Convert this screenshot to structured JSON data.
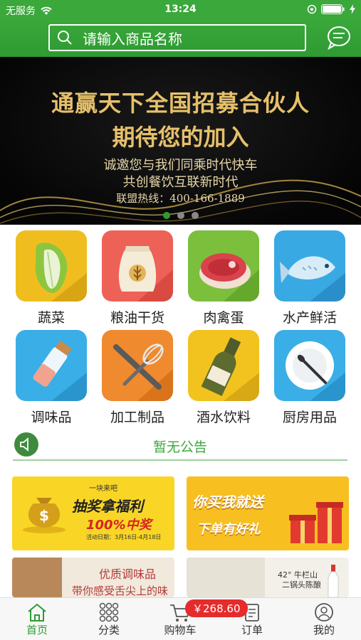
{
  "status": {
    "carrier": "无服务",
    "time": "13:24"
  },
  "search": {
    "placeholder": "请输入商品名称"
  },
  "banner": {
    "line1": "通赢天下全国招募合伙人",
    "line2": "期待您的加入",
    "line3": "诚邀您与我们同乘时代快车",
    "line4": "共创餐饮互联新时代",
    "hotline": "联盟热线：400-166-1889",
    "page_count": 3,
    "active_page": 1
  },
  "categories": [
    {
      "label": "蔬菜",
      "icon": "cabbage-icon",
      "color": "#f0bd1f"
    },
    {
      "label": "粮油干货",
      "icon": "grain-sack-icon",
      "color": "#ee6156"
    },
    {
      "label": "肉禽蛋",
      "icon": "meat-icon",
      "color": "#7cbf3c"
    },
    {
      "label": "水产鲜活",
      "icon": "fish-icon",
      "color": "#39a9e3"
    },
    {
      "label": "调味品",
      "icon": "salt-bottle-icon",
      "color": "#3aaee6"
    },
    {
      "label": "加工制品",
      "icon": "whisk-icon",
      "color": "#f08a2e"
    },
    {
      "label": "酒水饮料",
      "icon": "wine-bottle-icon",
      "color": "#f2c21e"
    },
    {
      "label": "厨房用品",
      "icon": "plate-icon",
      "color": "#3aaee6"
    }
  ],
  "notice": {
    "text": "暂无公告"
  },
  "promos": {
    "p1_title": "抽奖拿福利",
    "p1_sub": "100%中奖",
    "p1_tag": "一块来吧",
    "p1_date": "活动日期：3月16日-4月18日",
    "p2_title": "你买我就送",
    "p2_sub": "下单有好礼",
    "p3_title": "优质调味品",
    "p3_sub": "带你感受舌尖上的味道",
    "p4_title": "42° 牛栏山",
    "p4_sub": "二锅头陈酿"
  },
  "tabs": [
    {
      "label": "首页",
      "icon": "home-icon"
    },
    {
      "label": "分类",
      "icon": "grid-dots-icon"
    },
    {
      "label": "购物车",
      "icon": "cart-icon"
    },
    {
      "label": "订单",
      "icon": "order-list-icon"
    },
    {
      "label": "我的",
      "icon": "user-icon"
    }
  ],
  "cart": {
    "total": "￥268.60"
  },
  "colors": {
    "brand": "#2e9a33",
    "badge": "#e52b2b"
  }
}
